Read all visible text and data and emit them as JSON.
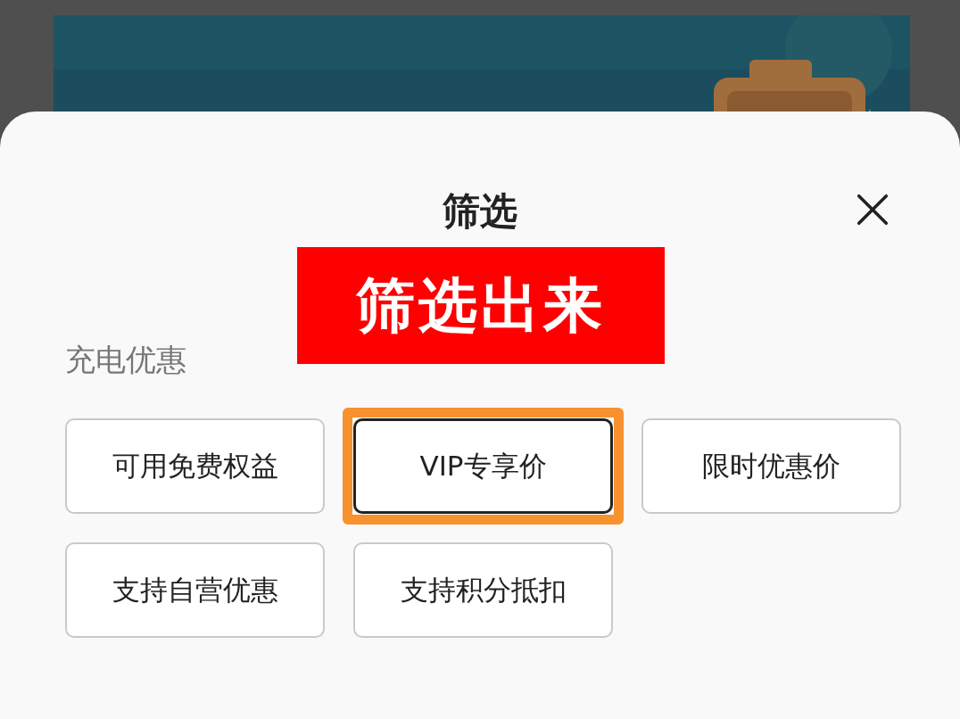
{
  "sheet": {
    "title": "筛选",
    "section_label": "充电优惠",
    "chips": [
      {
        "label": "可用免费权益",
        "selected": false,
        "highlighted": false
      },
      {
        "label": "VIP专享价",
        "selected": true,
        "highlighted": true
      },
      {
        "label": "限时优惠价",
        "selected": false,
        "highlighted": false
      },
      {
        "label": "支持自营优惠",
        "selected": false,
        "highlighted": false
      },
      {
        "label": "支持积分抵扣",
        "selected": false,
        "highlighted": false
      }
    ]
  },
  "annotation": {
    "text": "筛选出来"
  }
}
